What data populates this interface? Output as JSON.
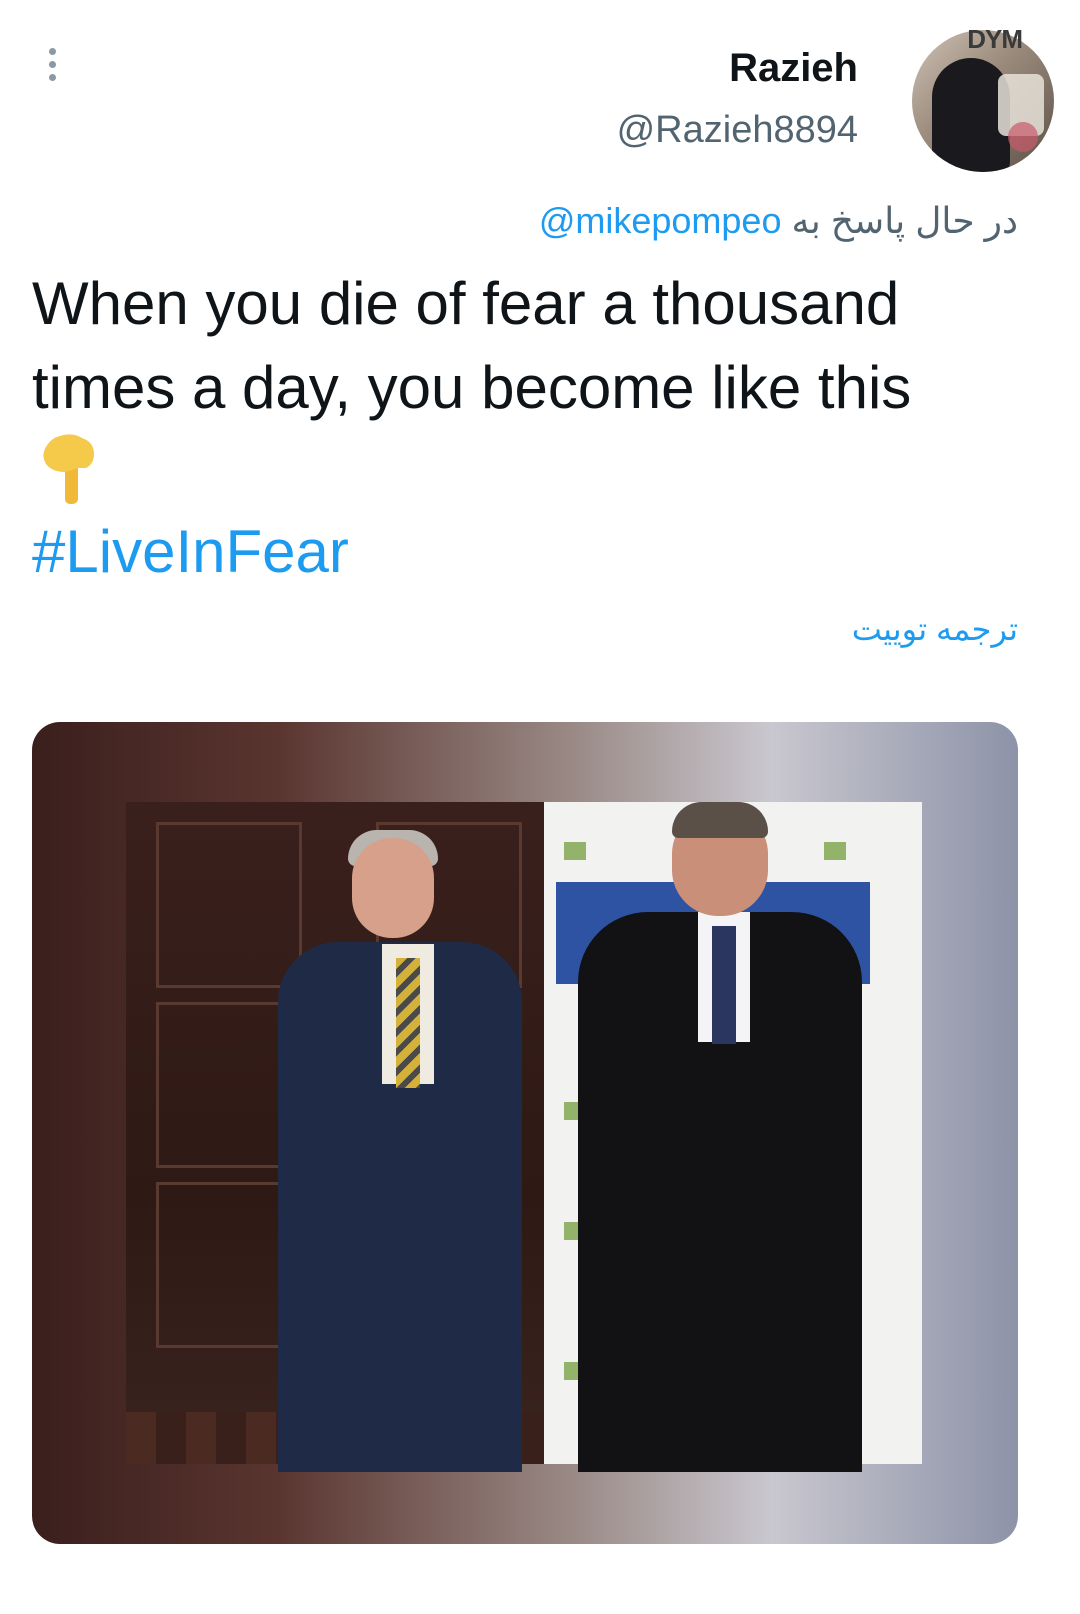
{
  "author": {
    "display_name": "Razieh",
    "handle": "@Razieh8894",
    "avatar_watermark": "DYM"
  },
  "reply": {
    "prefix": "در حال پاسخ به",
    "mention": "@mikepompeo"
  },
  "tweet": {
    "text": "When you die of fear a thousand times a day, you become like this",
    "emoji": "pointing-down-hand-icon",
    "hashtag": "#LiveInFear",
    "translate_label": "ترجمه توییت"
  },
  "media": {
    "type": "photo"
  },
  "colors": {
    "link": "#1d9bf0",
    "text": "#0f1419",
    "secondary": "#536471"
  }
}
